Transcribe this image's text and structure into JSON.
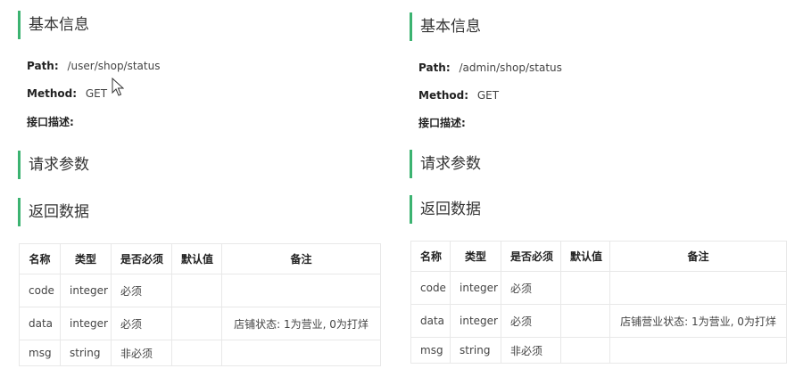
{
  "left": {
    "basic_info_heading": "基本信息",
    "path_label": "Path:",
    "path_value": "/user/shop/status",
    "method_label": "Method:",
    "method_value": "GET",
    "description_label": "接口描述:",
    "request_params_heading": "请求参数",
    "response_heading": "返回数据",
    "table": {
      "headers": [
        "名称",
        "类型",
        "是否必须",
        "默认值",
        "备注"
      ],
      "rows": [
        {
          "name": "code",
          "type": "integer",
          "required": "必须",
          "default": "",
          "note": ""
        },
        {
          "name": "data",
          "type": "integer",
          "required": "必须",
          "default": "",
          "note": "店铺状态: 1为营业, 0为打烊"
        },
        {
          "name": "msg",
          "type": "string",
          "required": "非必须",
          "default": "",
          "note": ""
        }
      ]
    }
  },
  "right": {
    "basic_info_heading": "基本信息",
    "path_label": "Path:",
    "path_value": "/admin/shop/status",
    "method_label": "Method:",
    "method_value": "GET",
    "description_label": "接口描述:",
    "request_params_heading": "请求参数",
    "response_heading": "返回数据",
    "table": {
      "headers": [
        "名称",
        "类型",
        "是否必须",
        "默认值",
        "备注"
      ],
      "rows": [
        {
          "name": "code",
          "type": "integer",
          "required": "必须",
          "default": "",
          "note": ""
        },
        {
          "name": "data",
          "type": "integer",
          "required": "必须",
          "default": "",
          "note": "店铺营业状态: 1为营业, 0为打烊"
        },
        {
          "name": "msg",
          "type": "string",
          "required": "非必须",
          "default": "",
          "note": ""
        }
      ]
    }
  },
  "colors": {
    "accent": "#3cb371",
    "border": "#e8e8e8",
    "text": "#333333"
  }
}
